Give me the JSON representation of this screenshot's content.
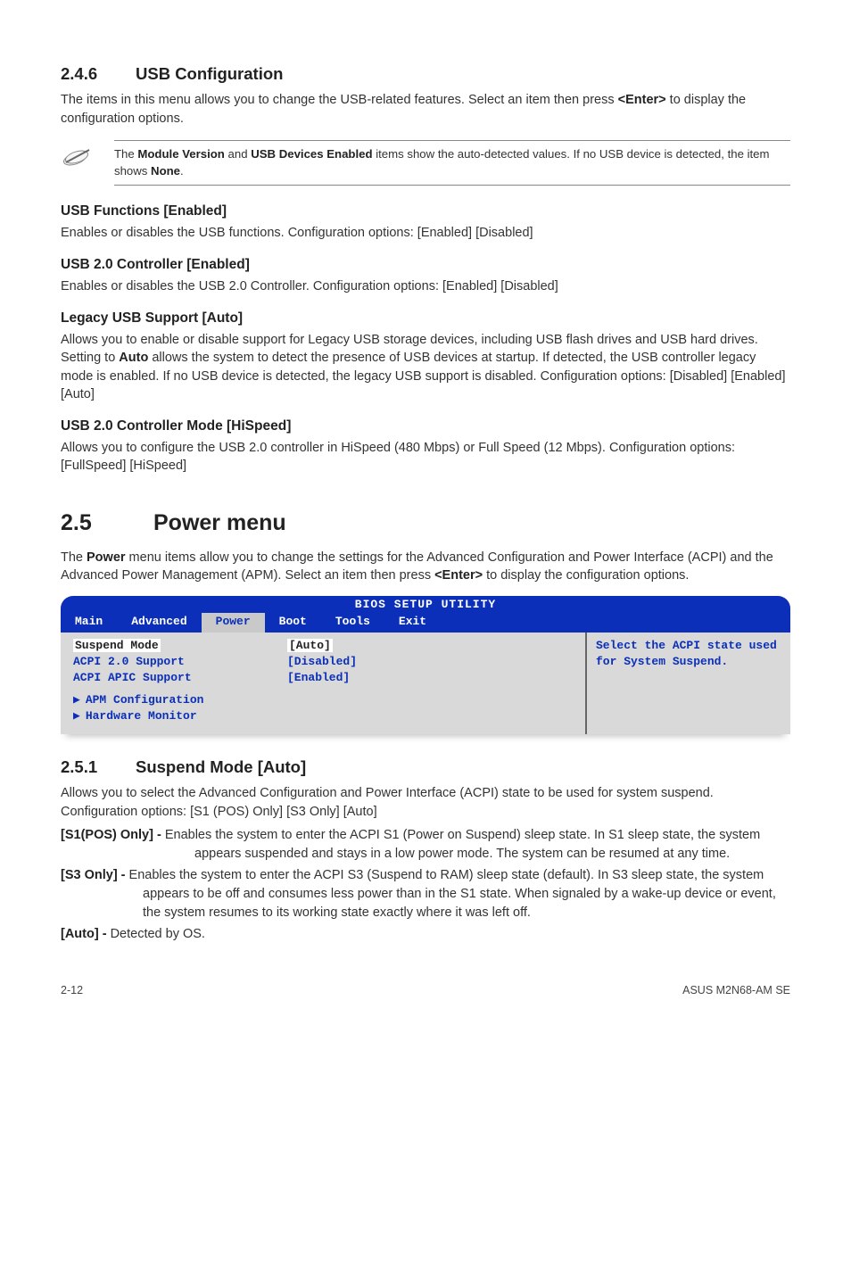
{
  "sec246": {
    "num": "2.4.6",
    "title": "USB Configuration",
    "intro": "The items in this menu allows you to change the USB-related features. Select an item then press <Enter> to display the configuration options.",
    "note": "The Module Version and USB Devices Enabled items show the auto-detected values. If no USB device is detected, the item shows None.",
    "items": [
      {
        "h": "USB Functions [Enabled]",
        "p": "Enables or disables the USB functions. Configuration options: [Enabled] [Disabled]"
      },
      {
        "h": "USB 2.0 Controller [Enabled]",
        "p": "Enables or disables the USB 2.0 Controller. Configuration options:  [Enabled] [Disabled]"
      },
      {
        "h": "Legacy USB Support [Auto]",
        "p": "Allows you to enable or disable support for Legacy USB storage devices, including USB flash drives and USB hard drives. Setting to Auto allows the system to detect the presence of USB devices at startup. If detected, the USB controller legacy mode is enabled. If no USB device is detected, the legacy USB support is disabled. Configuration options: [Disabled] [Enabled] [Auto]"
      },
      {
        "h": "USB 2.0 Controller Mode [HiSpeed]",
        "p": "Allows you to configure the USB 2.0 controller in HiSpeed (480 Mbps) or Full Speed (12 Mbps). Configuration options: [FullSpeed] [HiSpeed]"
      }
    ]
  },
  "sec25": {
    "num": "2.5",
    "title": "Power menu",
    "intro": "The Power menu items allow you to change the settings for the Advanced Configuration and Power Interface (ACPI) and the Advanced Power Management (APM). Select an item then press <Enter> to display the configuration options."
  },
  "bios": {
    "title": "BIOS SETUP UTILITY",
    "tabs": [
      "Main",
      "Advanced",
      "Power",
      "Boot",
      "Tools",
      "Exit"
    ],
    "active_tab": "Power",
    "rows": [
      {
        "label": "Suspend Mode",
        "value": "[Auto]",
        "highlight": true
      },
      {
        "label": "ACPI 2.0 Support",
        "value": "[Disabled]",
        "highlight": false
      },
      {
        "label": "ACPI APIC Support",
        "value": "[Enabled]",
        "highlight": false
      }
    ],
    "subs": [
      "APM Configuration",
      "Hardware Monitor"
    ],
    "help": "Select the ACPI state used for System Suspend."
  },
  "sec251": {
    "num": "2.5.1",
    "title": "Suspend Mode [Auto]",
    "p1": "Allows you to select the Advanced Configuration and Power Interface (ACPI) state to be used for system suspend. Configuration options: [S1 (POS) Only] [S3 Only] [Auto]",
    "s1_label": "[S1(POS) Only] - ",
    "s1_text": "Enables the system to enter the ACPI S1 (Power on Suspend) sleep state. In S1 sleep state, the system appears suspended and stays in a low power mode. The system can be resumed at any time.",
    "s3_label": "[S3 Only] - ",
    "s3_text": "Enables the system to enter the ACPI S3 (Suspend to RAM) sleep state (default). In S3 sleep state, the system appears to be off and consumes less power than in the S1 state. When signaled by a wake-up device or event, the system resumes to its working state exactly where it was left off.",
    "auto_label": "[Auto] - ",
    "auto_text": "Detected by OS."
  },
  "footer": {
    "left": "2-12",
    "right": "ASUS M2N68-AM SE"
  }
}
